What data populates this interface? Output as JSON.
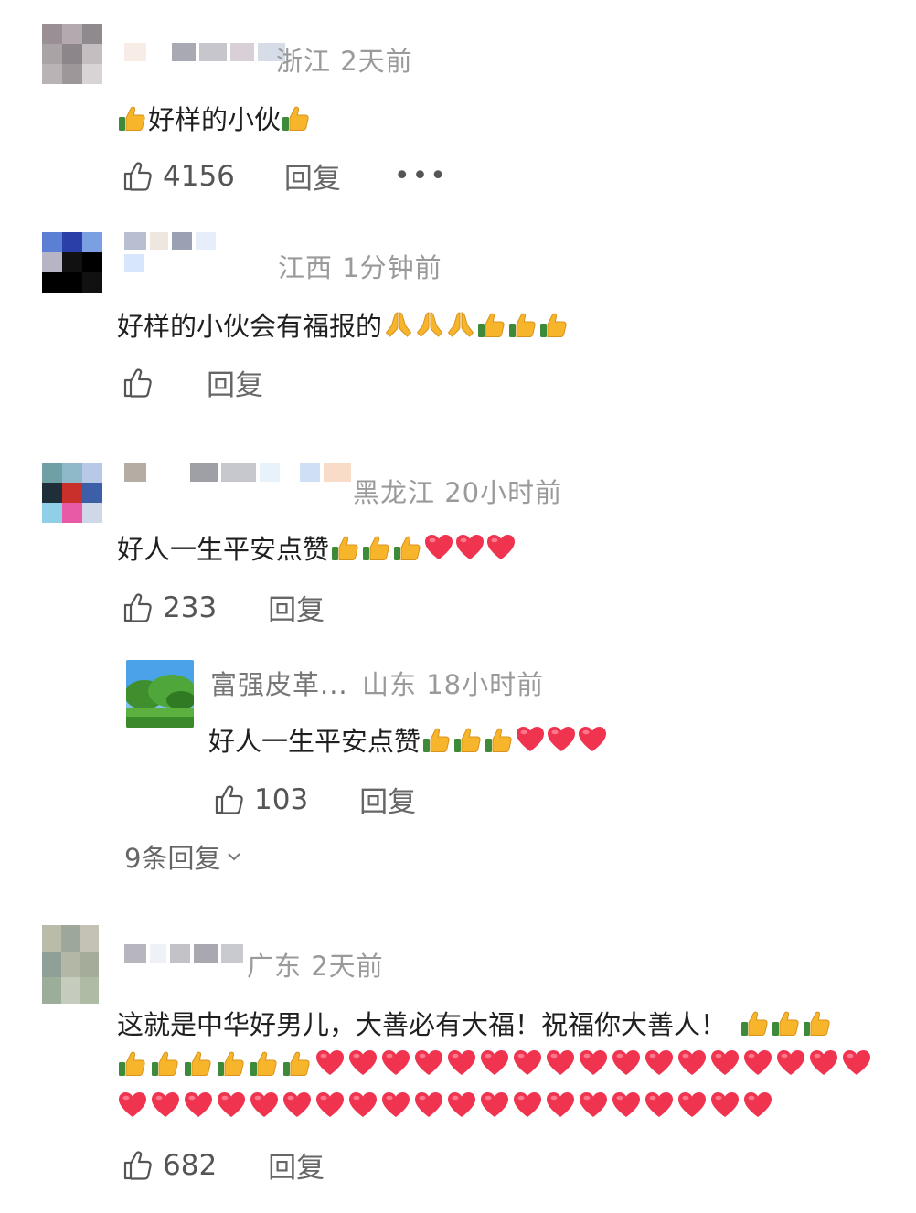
{
  "comments": [
    {
      "location_time": "浙江  2天前",
      "text": "好样的小伙",
      "likes": "4156",
      "reply_label": "回复",
      "more_label": "•••"
    },
    {
      "location_time": "江西  1分钟前",
      "text": "好样的小伙会有福报的",
      "likes": "",
      "reply_label": "回复"
    },
    {
      "location_time": "黑龙江  20小时前",
      "text": "好人一生平安点赞",
      "likes": "233",
      "reply_label": "回复",
      "sub_reply": {
        "author": "富强皮革...",
        "location_time": "山东  18小时前",
        "text": "好人一生平安点赞",
        "likes": "103",
        "reply_label": "回复"
      },
      "expand_label": "9条回复"
    },
    {
      "location_time": "广东  2天前",
      "text": "这就是中华好男儿，大善必有大福！祝福你大善人！",
      "likes": "682",
      "reply_label": "回复"
    }
  ],
  "icons": {
    "like": "thumbs-up-outline-icon",
    "thumbs_emoji": "thumbs-up-emoji",
    "heart_emoji": "red-heart-emoji",
    "pray_emoji": "praying-hands-emoji",
    "expand": "chevron-down-icon"
  },
  "colors": {
    "meta_gray": "#9a9a9a",
    "heart_red": "#f0334f",
    "thumb_yellow": "#f7b52c"
  }
}
